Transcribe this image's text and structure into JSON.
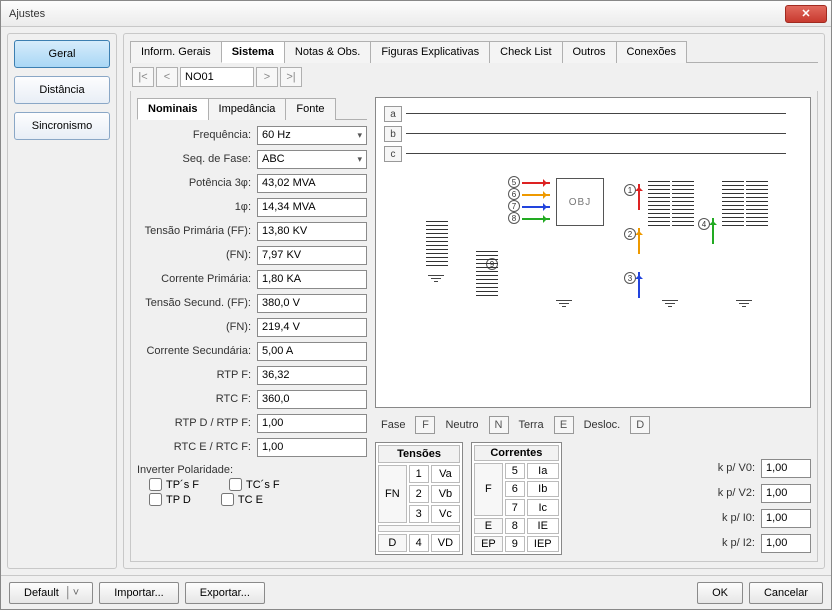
{
  "window": {
    "title": "Ajustes"
  },
  "sidebar": {
    "items": [
      {
        "label": "Geral",
        "active": true
      },
      {
        "label": "Distância",
        "active": false
      },
      {
        "label": "Sincronismo",
        "active": false
      }
    ]
  },
  "tabs": {
    "items": [
      {
        "label": "Inform. Gerais"
      },
      {
        "label": "Sistema",
        "active": true
      },
      {
        "label": "Notas & Obs."
      },
      {
        "label": "Figuras Explicativas"
      },
      {
        "label": "Check List"
      },
      {
        "label": "Outros"
      },
      {
        "label": "Conexões"
      }
    ]
  },
  "nav": {
    "first": "|<",
    "prev": "<",
    "node": "NO01",
    "next": ">",
    "last": ">|"
  },
  "subtabs": {
    "items": [
      {
        "label": "Nominais",
        "active": true
      },
      {
        "label": "Impedância"
      },
      {
        "label": "Fonte"
      }
    ]
  },
  "form": {
    "frequencia": {
      "label": "Frequência:",
      "value": "60 Hz"
    },
    "seqfase": {
      "label": "Seq. de Fase:",
      "value": "ABC"
    },
    "pot3": {
      "label": "Potência 3φ:",
      "value": "43,02 MVA"
    },
    "pot1": {
      "label": "1φ:",
      "value": "14,34 MVA"
    },
    "tprimff": {
      "label": "Tensão Primária (FF):",
      "value": "13,80 KV"
    },
    "tprimfn": {
      "label": "(FN):",
      "value": "7,97 KV"
    },
    "cprim": {
      "label": "Corrente Primária:",
      "value": "1,80 KA"
    },
    "tsecff": {
      "label": "Tensão Secund. (FF):",
      "value": "380,0 V"
    },
    "tsecfn": {
      "label": "(FN):",
      "value": "219,4 V"
    },
    "csec": {
      "label": "Corrente Secundária:",
      "value": "5,00 A"
    },
    "rtpf": {
      "label": "RTP F:",
      "value": "36,32"
    },
    "rtcf": {
      "label": "RTC F:",
      "value": "360,0"
    },
    "rtpd": {
      "label": "RTP D / RTP F:",
      "value": "1,00"
    },
    "rtce": {
      "label": "RTC E / RTC F:",
      "value": "1,00"
    }
  },
  "invert": {
    "title": "Inverter Polaridade:",
    "items": [
      {
        "label": "TP´s F"
      },
      {
        "label": "TC´s F"
      },
      {
        "label": "TP D"
      },
      {
        "label": "TC E"
      }
    ]
  },
  "phasebox": {
    "a": "a",
    "b": "b",
    "c": "c",
    "obj": "OBJ"
  },
  "legend": {
    "fase": "Fase",
    "f": "F",
    "neutro": "Neutro",
    "n": "N",
    "terra": "Terra",
    "e": "E",
    "desloc": "Desloc.",
    "d": "D"
  },
  "tensoes": {
    "title": "Tensões",
    "rows": [
      {
        "h": "FN",
        "n": "1",
        "v": "Va"
      },
      {
        "h": "",
        "n": "2",
        "v": "Vb"
      },
      {
        "h": "",
        "n": "3",
        "v": "Vc"
      },
      {
        "h": "D",
        "n": "4",
        "v": "VD"
      }
    ]
  },
  "correntes": {
    "title": "Correntes",
    "rows": [
      {
        "h": "F",
        "n": "5",
        "v": "Ia"
      },
      {
        "h": "",
        "n": "6",
        "v": "Ib"
      },
      {
        "h": "",
        "n": "7",
        "v": "Ic"
      },
      {
        "h": "E",
        "n": "8",
        "v": "IE"
      },
      {
        "h": "EP",
        "n": "9",
        "v": "IEP"
      }
    ]
  },
  "kp": {
    "v0": {
      "label": "k p/ V0:",
      "value": "1,00"
    },
    "v2": {
      "label": "k p/ V2:",
      "value": "1,00"
    },
    "i0": {
      "label": "k p/ I0:",
      "value": "1,00"
    },
    "i2": {
      "label": "k p/ I2:",
      "value": "1,00"
    }
  },
  "footer": {
    "default": "Default",
    "importar": "Importar...",
    "exportar": "Exportar...",
    "ok": "OK",
    "cancelar": "Cancelar"
  }
}
